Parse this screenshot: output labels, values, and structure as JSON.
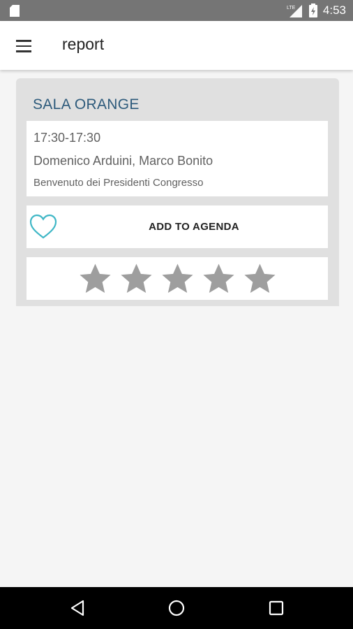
{
  "status_bar": {
    "network": "LTE",
    "time": "4:53"
  },
  "app_bar": {
    "title": "report"
  },
  "session": {
    "room": "SALA ORANGE",
    "time": "17:30-17:30",
    "speakers": "Domenico Arduini, Marco Bonito",
    "description": "Benvenuto dei Presidenti Congresso",
    "agenda_label": "ADD TO AGENDA",
    "rating": 0,
    "rating_max": 5
  },
  "colors": {
    "status_bar": "#757575",
    "room_title": "#2d5a7b",
    "heart": "#3fb7c6",
    "star": "#9e9e9e"
  }
}
